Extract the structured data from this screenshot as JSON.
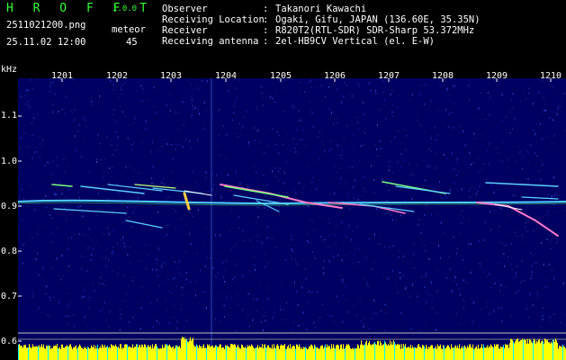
{
  "header": {
    "title": "H R O F F T",
    "version": "1.0.0",
    "file": "2511021200.png",
    "datetime": "25.11.02 12:00",
    "meteor_label": "meteor",
    "meteor_count": "45"
  },
  "info": [
    {
      "key": "Observer",
      "value": "Takanori Kawachi"
    },
    {
      "key": "Receiving Location",
      "value": "Ogaki, Gifu, JAPAN (136.60E, 35.35N)"
    },
    {
      "key": "Receiver",
      "value": "R820T2(RTL-SDR) SDR-Sharp 53.372MHz"
    },
    {
      "key": "Receiving antenna",
      "value": "2el-HB9CV Vertical (el. E-W)"
    }
  ],
  "axis": {
    "y_unit": "kHz",
    "y_ticks": [
      "1.1",
      "1.0",
      "0.9",
      "0.8",
      "0.7",
      "0.6"
    ],
    "x_ticks": [
      "1201",
      "1202",
      "1203",
      "1204",
      "1205",
      "1206",
      "1207",
      "1208",
      "1209",
      "1210"
    ]
  },
  "colors": {
    "background": "#000062",
    "title_green": "#33ff33",
    "spectrum_yellow": "#ffff00",
    "spectrum_cyan": "#00ffff"
  }
}
